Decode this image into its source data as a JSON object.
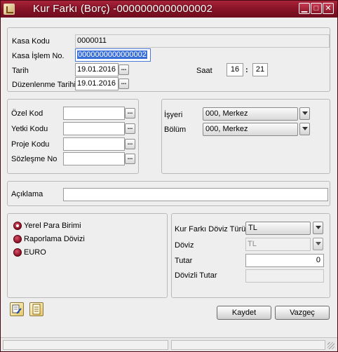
{
  "window": {
    "title": "Kur Farkı (Borç) -0000000000000002"
  },
  "header": {
    "kasa_kodu_label": "Kasa Kodu",
    "kasa_kodu_value": "0000011",
    "kasa_islem_no_label": "Kasa İşlem No.",
    "kasa_islem_no_value": "0000000000000002",
    "tarih_label": "Tarih",
    "tarih_value": "19.01.2016",
    "saat_label": "Saat",
    "saat_hour": "16",
    "saat_sep": ":",
    "saat_minute": "21",
    "duzenlenme_label": "Düzenlenme Tarihi",
    "duzenlenme_value": "19.01.2016"
  },
  "codes": {
    "ozel_kod_label": "Özel Kod",
    "ozel_kod_value": "",
    "yetki_kodu_label": "Yetki Kodu",
    "yetki_kodu_value": "",
    "proje_kodu_label": "Proje Kodu",
    "proje_kodu_value": "",
    "sozlesme_no_label": "Sözleşme No",
    "sozlesme_no_value": ""
  },
  "org": {
    "isyeri_label": "İşyeri",
    "isyeri_value": "000, Merkez",
    "bolum_label": "Bölüm",
    "bolum_value": "000, Merkez"
  },
  "aciklama": {
    "label": "Açıklama",
    "value": ""
  },
  "currency_options": {
    "options": [
      "Yerel Para Birimi",
      "Raporlama Dövizi",
      "EURO"
    ],
    "selected": "Yerel Para Birimi"
  },
  "exchange": {
    "kur_farki_doviz_turu_label": "Kur Farkı Döviz Türü",
    "kur_farki_doviz_turu_value": "TL",
    "doviz_label": "Döviz",
    "doviz_value": "TL",
    "tutar_label": "Tutar",
    "tutar_value": "0",
    "dovizli_tutar_label": "Dövizli Tutar",
    "dovizli_tutar_value": ""
  },
  "buttons": {
    "kaydet_label": "Kaydet",
    "vazgec_label": "Vazgeç",
    "minimize_glyph": "▁",
    "maximize_glyph": "□",
    "close_glyph": "✕",
    "dots_glyph": "..."
  },
  "colors": {
    "titlebar": "#8a1428",
    "selection": "#3a6fd8",
    "radio": "#8a0e22"
  },
  "icons": {
    "title_icon": "document-icon",
    "toolbar_icon_1": "edit-icon",
    "toolbar_icon_2": "notes-icon"
  }
}
